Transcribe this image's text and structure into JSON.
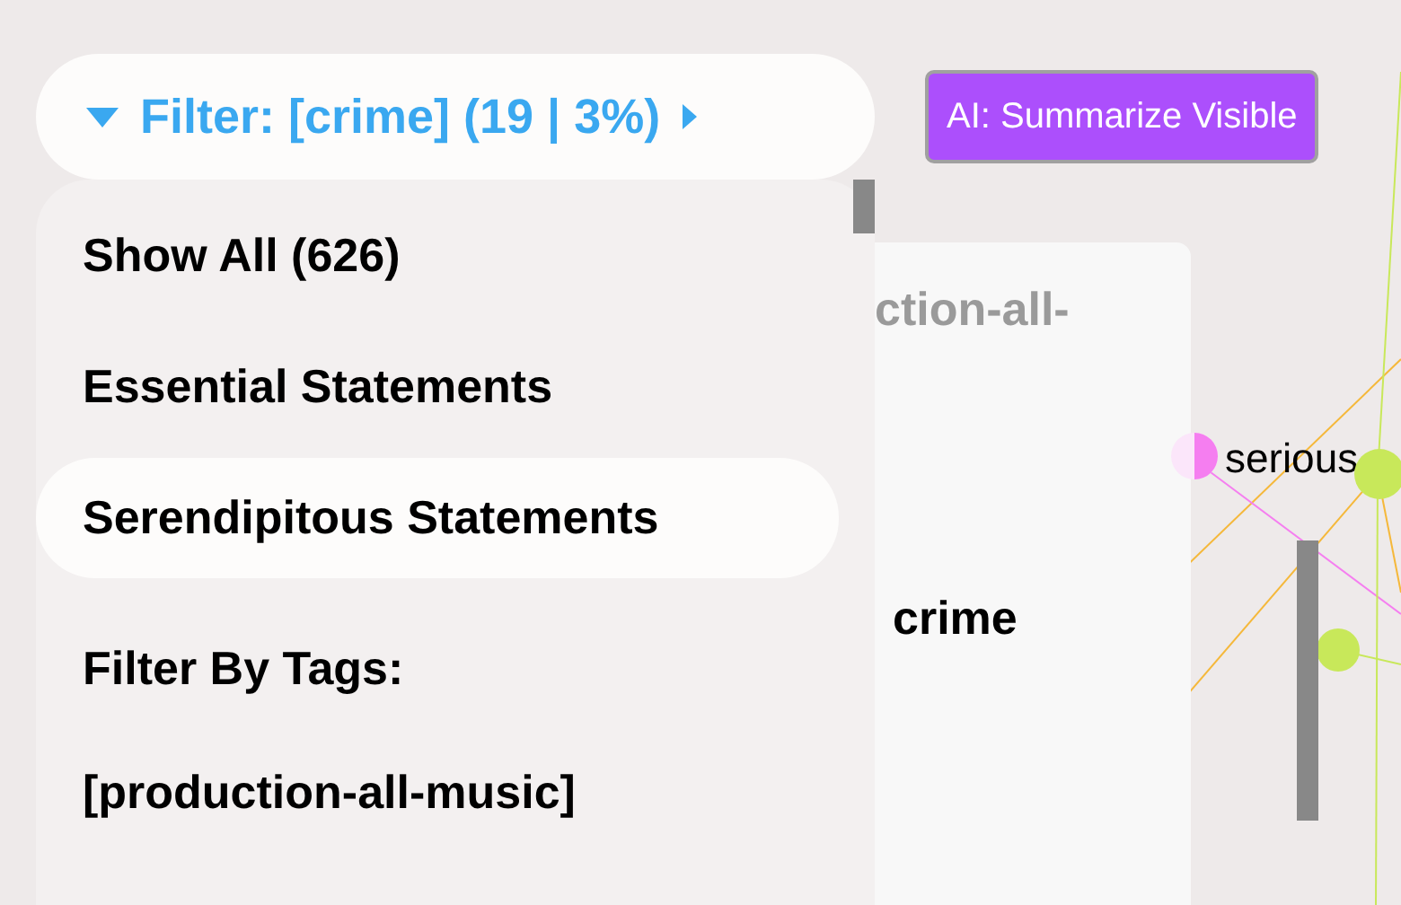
{
  "filter_button": {
    "label": "Filter: [crime] (19 | 3%)"
  },
  "summarize_button": {
    "label": "AI: Summarize Visible"
  },
  "card": {
    "tags_fragment": "ction-all-",
    "keyword": "crime"
  },
  "filter_menu": {
    "items": [
      {
        "label": "Show All (626)",
        "selected": false
      },
      {
        "label": "Essential Statements",
        "selected": false
      },
      {
        "label": "Serendipitous Statements",
        "selected": true
      }
    ],
    "section_title": "Filter By Tags:",
    "tags": [
      {
        "label": "[production-all-music]",
        "selected": false
      }
    ]
  },
  "graph": {
    "nodes": [
      {
        "label": "serious",
        "color": "#f57ef0"
      },
      {
        "color": "#c8e85a"
      },
      {
        "color": "#c8e85a"
      }
    ]
  }
}
